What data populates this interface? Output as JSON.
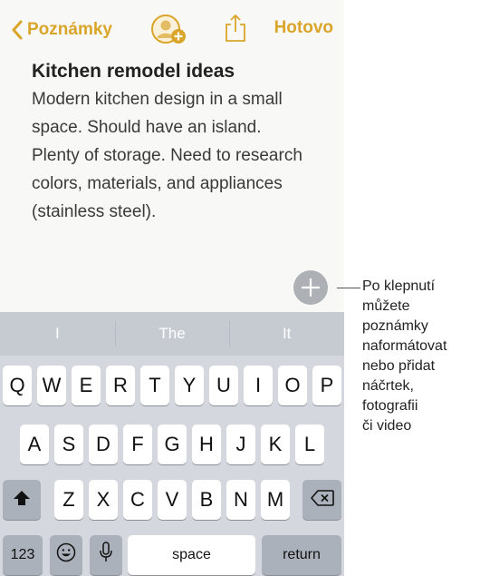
{
  "colors": {
    "accent": "#d9a52a",
    "plus_button": "#adb1b6",
    "keyboard_bg": "#d4d7dd"
  },
  "nav": {
    "back_label": "Poznámky",
    "done_label": "Hotovo",
    "icons": [
      "chevron-left-icon",
      "add-person-icon",
      "share-icon"
    ]
  },
  "note": {
    "title": "Kitchen remodel ideas",
    "lines": [
      "Modern kitchen design in a small",
      "space. Should have an island.",
      "Plenty of storage. Need to research",
      "colors, materials, and appliances",
      "(stainless steel)."
    ]
  },
  "keyboard": {
    "suggestions": [
      "I",
      "The",
      "It"
    ],
    "row1": [
      "Q",
      "W",
      "E",
      "R",
      "T",
      "Y",
      "U",
      "I",
      "O",
      "P"
    ],
    "row2": [
      "A",
      "S",
      "D",
      "F",
      "G",
      "H",
      "J",
      "K",
      "L"
    ],
    "row3": [
      "Z",
      "X",
      "C",
      "V",
      "B",
      "N",
      "M"
    ],
    "numbers_label": "123",
    "space_label": "space",
    "return_label": "return",
    "icons": [
      "shift-icon",
      "delete-icon",
      "emoji-icon",
      "microphone-icon"
    ]
  },
  "callout": {
    "lines": [
      "Po klepnutí",
      "můžete",
      "poznámky",
      "naformátovat",
      "nebo přidat",
      "náčrtek,",
      "fotografii",
      "či video"
    ]
  }
}
